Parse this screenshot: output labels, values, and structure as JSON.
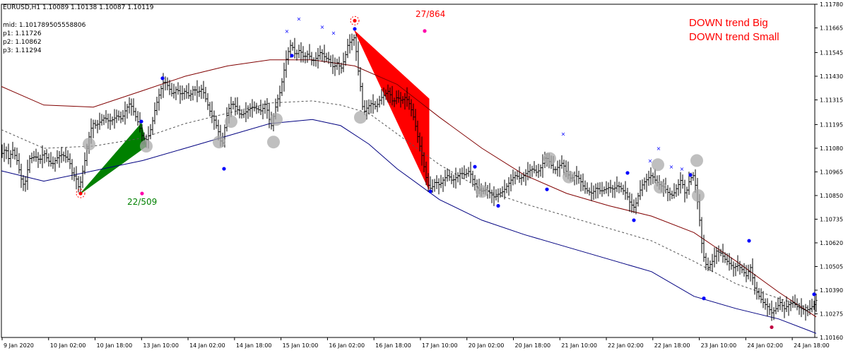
{
  "header": {
    "title": "EURUSD,H1  1.10089 1.10138 1.10087 1.10119",
    "mid": "mid: 1.101789505558806",
    "p1": "p1: 1.11726",
    "p2": "p2: 1.10862",
    "p3": "p3: 1.11294"
  },
  "signals": {
    "big": "DOWN trend Big",
    "small": "DOWN trend Small",
    "big_count": "22/509",
    "small_count": "27/864",
    "up_color": "#008000",
    "down_color": "#ff0000"
  },
  "chart_data": {
    "type": "candlestick",
    "symbol": "EURUSD",
    "timeframe": "H1",
    "ylim": [
      1.1016,
      1.1178
    ],
    "y_ticks": [
      "1.11780",
      "1.11665",
      "1.11545",
      "1.11430",
      "1.11315",
      "1.11195",
      "1.11080",
      "1.10965",
      "1.10850",
      "1.10735",
      "1.10620",
      "1.10505",
      "1.10390",
      "1.10275",
      "1.10160"
    ],
    "x_ticks": [
      "9 Jan 2020",
      "10 Jan 02:00",
      "10 Jan 18:00",
      "13 Jan 10:00",
      "14 Jan 02:00",
      "14 Jan 18:00",
      "15 Jan 10:00",
      "16 Jan 02:00",
      "16 Jan 18:00",
      "17 Jan 10:00",
      "20 Jan 02:00",
      "20 Jan 18:00",
      "21 Jan 10:00",
      "22 Jan 02:00",
      "22 Jan 18:00",
      "23 Jan 10:00",
      "24 Jan 02:00",
      "24 Jan 18:00"
    ],
    "price_path": [
      [
        0,
        1.1105
      ],
      [
        6,
        1.1108
      ],
      [
        10,
        1.1103
      ],
      [
        16,
        1.1107
      ],
      [
        22,
        1.1102
      ],
      [
        26,
        1.1096
      ],
      [
        30,
        1.109
      ],
      [
        34,
        1.1092
      ],
      [
        40,
        1.1103
      ],
      [
        48,
        1.1104
      ],
      [
        54,
        1.1102
      ],
      [
        60,
        1.1106
      ],
      [
        66,
        1.1102
      ],
      [
        72,
        1.11
      ],
      [
        78,
        1.1103
      ],
      [
        84,
        1.1105
      ],
      [
        90,
        1.1104
      ],
      [
        96,
        1.1102
      ],
      [
        100,
        1.1096
      ],
      [
        106,
        1.1093
      ],
      [
        110,
        1.1088
      ],
      [
        114,
        1.1095
      ],
      [
        118,
        1.1102
      ],
      [
        122,
        1.111
      ],
      [
        126,
        1.1117
      ],
      [
        130,
        1.112
      ],
      [
        134,
        1.1119
      ],
      [
        140,
        1.1121
      ],
      [
        146,
        1.1123
      ],
      [
        152,
        1.1121
      ],
      [
        158,
        1.1122
      ],
      [
        164,
        1.1124
      ],
      [
        170,
        1.1122
      ],
      [
        176,
        1.1127
      ],
      [
        182,
        1.113
      ],
      [
        188,
        1.1125
      ],
      [
        194,
        1.112
      ],
      [
        200,
        1.1113
      ],
      [
        206,
        1.1112
      ],
      [
        212,
        1.1118
      ],
      [
        218,
        1.1128
      ],
      [
        224,
        1.1135
      ],
      [
        230,
        1.1141
      ],
      [
        236,
        1.1138
      ],
      [
        242,
        1.1134
      ],
      [
        248,
        1.1137
      ],
      [
        254,
        1.1134
      ],
      [
        260,
        1.1136
      ],
      [
        266,
        1.1133
      ],
      [
        272,
        1.1137
      ],
      [
        278,
        1.1135
      ],
      [
        284,
        1.1137
      ],
      [
        290,
        1.1131
      ],
      [
        296,
        1.1125
      ],
      [
        302,
        1.1121
      ],
      [
        308,
        1.1115
      ],
      [
        312,
        1.1108
      ],
      [
        316,
        1.1118
      ],
      [
        320,
        1.1126
      ],
      [
        326,
        1.113
      ],
      [
        332,
        1.1128
      ],
      [
        338,
        1.1124
      ],
      [
        344,
        1.1125
      ],
      [
        350,
        1.1127
      ],
      [
        356,
        1.1128
      ],
      [
        362,
        1.1127
      ],
      [
        368,
        1.1126
      ],
      [
        374,
        1.113
      ],
      [
        378,
        1.1123
      ],
      [
        382,
        1.1119
      ],
      [
        386,
        1.1125
      ],
      [
        390,
        1.1131
      ],
      [
        394,
        1.1135
      ],
      [
        398,
        1.1142
      ],
      [
        402,
        1.115
      ],
      [
        406,
        1.1155
      ],
      [
        410,
        1.1159
      ],
      [
        416,
        1.1153
      ],
      [
        422,
        1.1156
      ],
      [
        428,
        1.1152
      ],
      [
        434,
        1.1154
      ],
      [
        440,
        1.115
      ],
      [
        446,
        1.1152
      ],
      [
        452,
        1.1155
      ],
      [
        458,
        1.1152
      ],
      [
        464,
        1.1151
      ],
      [
        470,
        1.1147
      ],
      [
        476,
        1.115
      ],
      [
        480,
        1.1146
      ],
      [
        486,
        1.1152
      ],
      [
        490,
        1.1158
      ],
      [
        494,
        1.116
      ],
      [
        500,
        1.1162
      ],
      [
        504,
        1.1148
      ],
      [
        508,
        1.1138
      ],
      [
        512,
        1.1125
      ],
      [
        518,
        1.1128
      ],
      [
        524,
        1.113
      ],
      [
        530,
        1.1128
      ],
      [
        536,
        1.1132
      ],
      [
        542,
        1.1134
      ],
      [
        548,
        1.1136
      ],
      [
        554,
        1.113
      ],
      [
        560,
        1.1133
      ],
      [
        566,
        1.1131
      ],
      [
        572,
        1.1133
      ],
      [
        578,
        1.1129
      ],
      [
        584,
        1.1122
      ],
      [
        590,
        1.1112
      ],
      [
        596,
        1.1103
      ],
      [
        600,
        1.1095
      ],
      [
        604,
        1.109
      ],
      [
        608,
        1.1088
      ],
      [
        614,
        1.1092
      ],
      [
        620,
        1.109
      ],
      [
        626,
        1.1093
      ],
      [
        632,
        1.1095
      ],
      [
        638,
        1.1092
      ],
      [
        644,
        1.1094
      ],
      [
        650,
        1.1096
      ],
      [
        656,
        1.1095
      ],
      [
        662,
        1.1097
      ],
      [
        668,
        1.1092
      ],
      [
        674,
        1.1088
      ],
      [
        680,
        1.1087
      ],
      [
        686,
        1.1088
      ],
      [
        692,
        1.1086
      ],
      [
        698,
        1.1084
      ],
      [
        704,
        1.1086
      ],
      [
        710,
        1.1087
      ],
      [
        716,
        1.109
      ],
      [
        722,
        1.1093
      ],
      [
        728,
        1.1095
      ],
      [
        734,
        1.1093
      ],
      [
        740,
        1.1095
      ],
      [
        746,
        1.1097
      ],
      [
        752,
        1.1098
      ],
      [
        758,
        1.1096
      ],
      [
        764,
        1.1099
      ],
      [
        770,
        1.1104
      ],
      [
        776,
        1.1101
      ],
      [
        782,
        1.1097
      ],
      [
        788,
        1.1099
      ],
      [
        794,
        1.1101
      ],
      [
        800,
        1.1096
      ],
      [
        806,
        1.1093
      ],
      [
        812,
        1.1095
      ],
      [
        818,
        1.1093
      ],
      [
        824,
        1.1089
      ],
      [
        830,
        1.1087
      ],
      [
        836,
        1.1086
      ],
      [
        842,
        1.1089
      ],
      [
        848,
        1.1087
      ],
      [
        854,
        1.1088
      ],
      [
        860,
        1.1089
      ],
      [
        866,
        1.1088
      ],
      [
        872,
        1.109
      ],
      [
        878,
        1.1088
      ],
      [
        884,
        1.1086
      ],
      [
        890,
        1.1081
      ],
      [
        896,
        1.1079
      ],
      [
        902,
        1.1086
      ],
      [
        908,
        1.1091
      ],
      [
        914,
        1.1093
      ],
      [
        920,
        1.1095
      ],
      [
        926,
        1.1092
      ],
      [
        932,
        1.109
      ],
      [
        938,
        1.1089
      ],
      [
        944,
        1.1086
      ],
      [
        950,
        1.1085
      ],
      [
        956,
        1.1089
      ],
      [
        962,
        1.1093
      ],
      [
        968,
        1.1085
      ],
      [
        974,
        1.1093
      ],
      [
        980,
        1.1095
      ],
      [
        984,
        1.1085
      ],
      [
        988,
        1.1073
      ],
      [
        992,
        1.1058
      ],
      [
        996,
        1.1052
      ],
      [
        1000,
        1.105
      ],
      [
        1006,
        1.1053
      ],
      [
        1012,
        1.1058
      ],
      [
        1018,
        1.1057
      ],
      [
        1024,
        1.1054
      ],
      [
        1030,
        1.1052
      ],
      [
        1036,
        1.105
      ],
      [
        1042,
        1.1051
      ],
      [
        1048,
        1.1049
      ],
      [
        1054,
        1.1046
      ],
      [
        1060,
        1.105
      ],
      [
        1066,
        1.104
      ],
      [
        1072,
        1.1036
      ],
      [
        1078,
        1.1033
      ],
      [
        1084,
        1.1031
      ],
      [
        1090,
        1.1028
      ],
      [
        1096,
        1.103
      ],
      [
        1102,
        1.1033
      ],
      [
        1108,
        1.103
      ],
      [
        1114,
        1.1032
      ],
      [
        1120,
        1.1033
      ],
      [
        1126,
        1.1031
      ],
      [
        1132,
        1.103
      ],
      [
        1138,
        1.1029
      ],
      [
        1144,
        1.103
      ],
      [
        1150,
        1.1032
      ],
      [
        1153,
        1.1034
      ]
    ],
    "upper_band": [
      [
        0,
        1.1138
      ],
      [
        60,
        1.1129
      ],
      [
        130,
        1.1128
      ],
      [
        200,
        1.1136
      ],
      [
        260,
        1.1143
      ],
      [
        320,
        1.1148
      ],
      [
        380,
        1.1151
      ],
      [
        440,
        1.1151
      ],
      [
        500,
        1.1148
      ],
      [
        560,
        1.1139
      ],
      [
        620,
        1.1123
      ],
      [
        680,
        1.1108
      ],
      [
        740,
        1.1095
      ],
      [
        800,
        1.1086
      ],
      [
        860,
        1.108
      ],
      [
        920,
        1.1075
      ],
      [
        980,
        1.1067
      ],
      [
        1040,
        1.1053
      ],
      [
        1100,
        1.1038
      ],
      [
        1153,
        1.1026
      ]
    ],
    "middle_band": [
      [
        0,
        1.1117
      ],
      [
        60,
        1.1108
      ],
      [
        130,
        1.1109
      ],
      [
        200,
        1.1113
      ],
      [
        260,
        1.112
      ],
      [
        320,
        1.1125
      ],
      [
        380,
        1.113
      ],
      [
        440,
        1.1131
      ],
      [
        480,
        1.1129
      ],
      [
        520,
        1.1125
      ],
      [
        560,
        1.1115
      ],
      [
        620,
        1.11
      ],
      [
        680,
        1.1088
      ],
      [
        740,
        1.1081
      ],
      [
        800,
        1.1075
      ],
      [
        860,
        1.1069
      ],
      [
        920,
        1.1063
      ],
      [
        980,
        1.1053
      ],
      [
        1040,
        1.1042
      ],
      [
        1100,
        1.1035
      ],
      [
        1153,
        1.1029
      ]
    ],
    "lower_band": [
      [
        0,
        1.1097
      ],
      [
        60,
        1.1092
      ],
      [
        130,
        1.1097
      ],
      [
        200,
        1.1102
      ],
      [
        260,
        1.1108
      ],
      [
        320,
        1.1114
      ],
      [
        380,
        1.112
      ],
      [
        440,
        1.1122
      ],
      [
        480,
        1.1119
      ],
      [
        520,
        1.111
      ],
      [
        560,
        1.1098
      ],
      [
        620,
        1.1083
      ],
      [
        680,
        1.1073
      ],
      [
        740,
        1.1066
      ],
      [
        800,
        1.106
      ],
      [
        860,
        1.1054
      ],
      [
        920,
        1.1048
      ],
      [
        980,
        1.1036
      ],
      [
        1040,
        1.103
      ],
      [
        1100,
        1.1025
      ],
      [
        1153,
        1.1018
      ]
    ],
    "up_triangle": [
      [
        112,
        1.1086
      ],
      [
        198,
        1.112
      ],
      [
        205,
        1.1109
      ]
    ],
    "down_triangle": [
      [
        500,
        1.1165
      ],
      [
        605,
        1.1088
      ],
      [
        605,
        1.1132
      ]
    ],
    "points": [
      {
        "x": 228,
        "y": 1.1142,
        "color": "#0000ff"
      },
      {
        "x": 198,
        "y": 1.1121,
        "color": "#0000ff"
      },
      {
        "x": 315,
        "y": 1.1098,
        "color": "#0000ff"
      },
      {
        "x": 411,
        "y": 1.1153,
        "color": "#0000ff"
      },
      {
        "x": 500,
        "y": 1.1166,
        "color": "#0000ff"
      },
      {
        "x": 607,
        "y": 1.1087,
        "color": "#0000ff"
      },
      {
        "x": 670,
        "y": 1.1099,
        "color": "#0000ff"
      },
      {
        "x": 703,
        "y": 1.108,
        "color": "#0000ff"
      },
      {
        "x": 772,
        "y": 1.1088,
        "color": "#0000ff"
      },
      {
        "x": 886,
        "y": 1.1096,
        "color": "#0000ff"
      },
      {
        "x": 895,
        "y": 1.1073,
        "color": "#0000ff"
      },
      {
        "x": 975,
        "y": 1.1095,
        "color": "#0000ff"
      },
      {
        "x": 994,
        "y": 1.1035,
        "color": "#0000ff"
      },
      {
        "x": 1058,
        "y": 1.1063,
        "color": "#0000ff"
      },
      {
        "x": 1150,
        "y": 1.1037,
        "color": "#0000ff"
      },
      {
        "x": 1090,
        "y": 1.1021,
        "color": "#c00040"
      },
      {
        "x": 599,
        "y": 1.1165,
        "color": "#ff00aa"
      },
      {
        "x": 199,
        "y": 1.1086,
        "color": "#ff00aa"
      },
      {
        "x": 112,
        "y": 1.1086,
        "color": "#ff0000"
      },
      {
        "x": 500,
        "y": 1.117,
        "color": "#ff0000"
      }
    ],
    "circles": [
      {
        "x": 124,
        "y": 1.111
      },
      {
        "x": 205,
        "y": 1.1109
      },
      {
        "x": 308,
        "y": 1.1111
      },
      {
        "x": 325,
        "y": 1.1121
      },
      {
        "x": 385,
        "y": 1.1111
      },
      {
        "x": 389,
        "y": 1.1122
      },
      {
        "x": 508,
        "y": 1.1123
      },
      {
        "x": 680,
        "y": 1.1087
      },
      {
        "x": 776,
        "y": 1.1103
      },
      {
        "x": 803,
        "y": 1.1094
      },
      {
        "x": 929,
        "y": 1.11
      },
      {
        "x": 932,
        "y": 1.1089
      },
      {
        "x": 984,
        "y": 1.1102
      },
      {
        "x": 986,
        "y": 1.1085
      }
    ]
  }
}
